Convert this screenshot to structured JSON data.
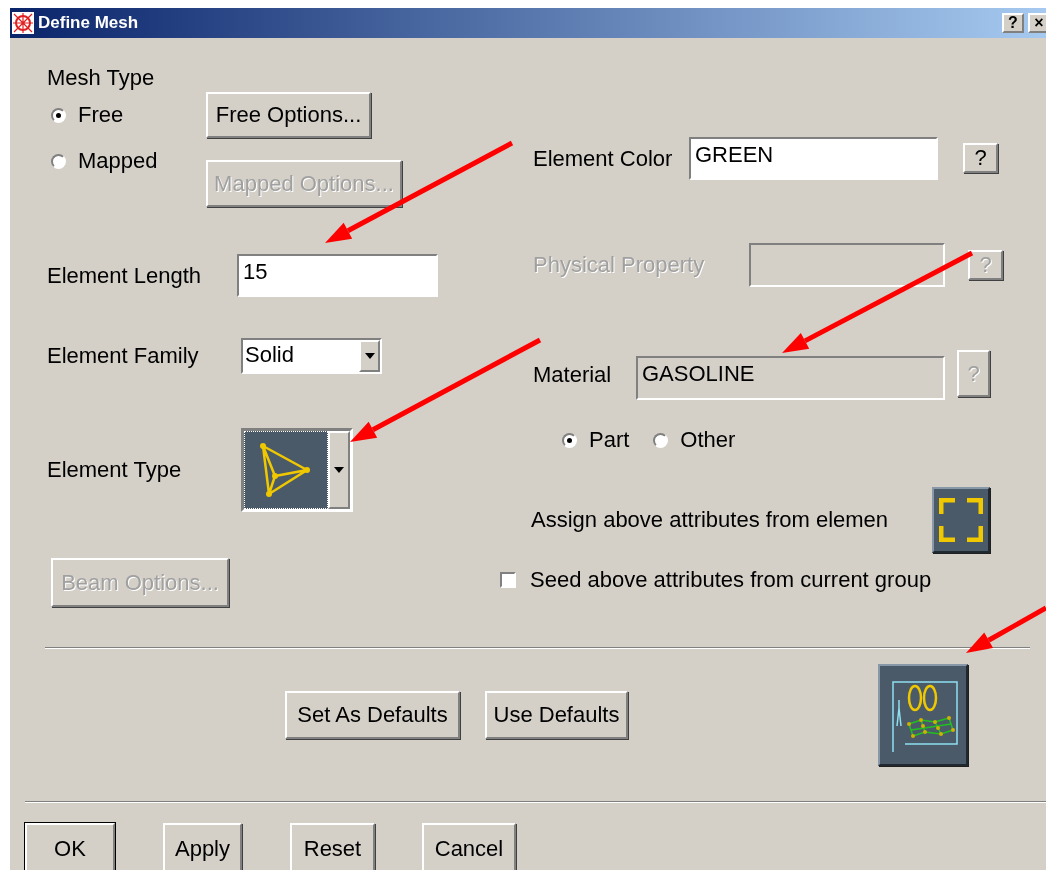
{
  "window": {
    "title": "Define Mesh",
    "title_buttons": [
      "?",
      "×"
    ]
  },
  "mesh_type": {
    "label": "Mesh Type",
    "options": [
      {
        "label": "Free",
        "selected": true
      },
      {
        "label": "Mapped",
        "selected": false
      }
    ]
  },
  "option_buttons": [
    {
      "label": "Free Options...",
      "disabled": false
    },
    {
      "label": "Mapped Options...",
      "disabled": true
    }
  ],
  "element_length": {
    "label": "Element Length",
    "value": "15"
  },
  "element_family": {
    "label": "Element Family",
    "value": "Solid"
  },
  "element_type": {
    "label": "Element Type"
  },
  "beam_options": {
    "label": "Beam Options...",
    "disabled": true
  },
  "element_color": {
    "label": "Element Color",
    "value": "GREEN",
    "help": "?"
  },
  "physical_property": {
    "label": "Physical Property",
    "help": "?",
    "disabled": true
  },
  "material": {
    "label": "Material",
    "value": "GASOLINE",
    "help": "?",
    "readonly": true
  },
  "material_scope": [
    {
      "label": "Part",
      "selected": true
    },
    {
      "label": "Other",
      "selected": false
    }
  ],
  "assign": {
    "label": "Assign above attributes from elemen"
  },
  "seed": {
    "label": "Seed above attributes from current group",
    "checked": false
  },
  "default_buttons": [
    "Set As Defaults",
    "Use Defaults"
  ],
  "dialog_buttons": [
    {
      "label": "OK",
      "default": true
    },
    {
      "label": "Apply",
      "default": false
    },
    {
      "label": "Reset",
      "default": false
    },
    {
      "label": "Cancel",
      "default": false
    }
  ]
}
